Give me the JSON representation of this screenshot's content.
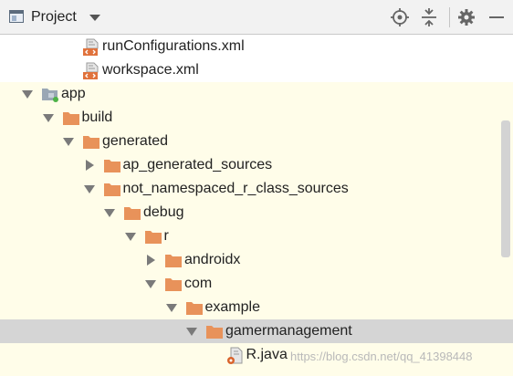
{
  "header": {
    "title": "Project",
    "buttons": [
      "locate-icon",
      "collapse-all-icon",
      "gear-icon",
      "minimize-icon"
    ]
  },
  "tree": {
    "items": [
      {
        "label": "runConfigurations.xml",
        "icon": "xml-file-icon",
        "arrow": "none",
        "depth": 2
      },
      {
        "label": "workspace.xml",
        "icon": "xml-file-icon",
        "arrow": "none",
        "depth": 2
      },
      {
        "label": "app",
        "icon": "module-folder-icon",
        "arrow": "expanded",
        "depth": 0
      },
      {
        "label": "build",
        "icon": "folder-icon",
        "arrow": "expanded",
        "depth": 1
      },
      {
        "label": "generated",
        "icon": "folder-icon",
        "arrow": "expanded",
        "depth": 2
      },
      {
        "label": "ap_generated_sources",
        "icon": "folder-icon",
        "arrow": "collapsed",
        "depth": 3
      },
      {
        "label": "not_namespaced_r_class_sources",
        "icon": "folder-icon",
        "arrow": "expanded",
        "depth": 3
      },
      {
        "label": "debug",
        "icon": "folder-icon",
        "arrow": "expanded",
        "depth": 4
      },
      {
        "label": "r",
        "icon": "folder-icon",
        "arrow": "expanded",
        "depth": 5
      },
      {
        "label": "androidx",
        "icon": "folder-icon",
        "arrow": "collapsed",
        "depth": 6
      },
      {
        "label": "com",
        "icon": "folder-icon",
        "arrow": "expanded",
        "depth": 6
      },
      {
        "label": "example",
        "icon": "folder-icon",
        "arrow": "expanded",
        "depth": 7
      },
      {
        "label": "gamermanagement",
        "icon": "folder-icon",
        "arrow": "expanded",
        "depth": 8,
        "selected": true
      },
      {
        "label": "R.java",
        "icon": "java-file-icon",
        "arrow": "none",
        "depth": 9
      }
    ]
  },
  "watermark": "https://blog.csdn.net/qq_41398448",
  "colors": {
    "folder": "#e8925a",
    "selected_row": "#d5d5d5",
    "highlight_rows": "#fffde9",
    "header_bg": "#f2f2f2"
  }
}
